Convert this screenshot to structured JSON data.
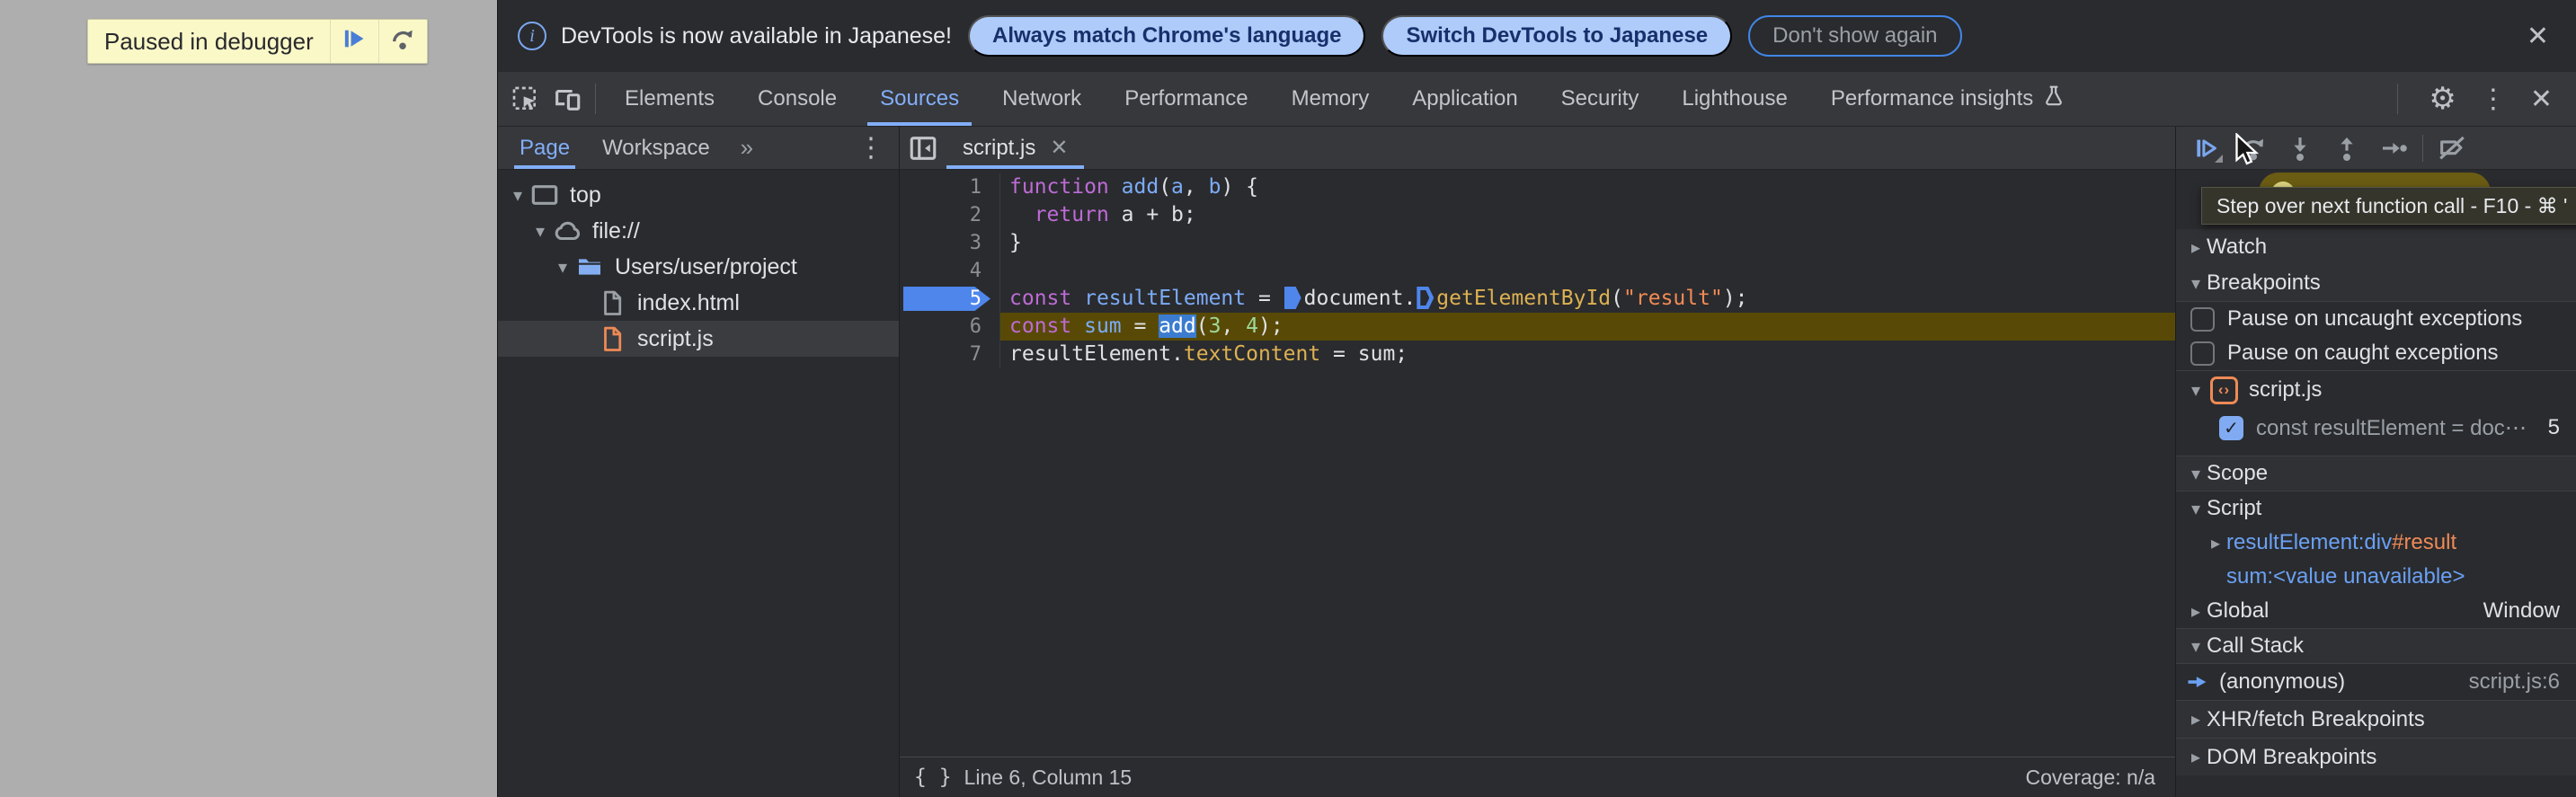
{
  "colors": {
    "accent_blue": "#82aef8",
    "breakpoint_blue": "#4e86ec",
    "paused_line": "#584a06",
    "string_orange": "#f28b54",
    "keyword_purple": "#bd6bd6",
    "banner_yellow": "#fbf8c8",
    "pill_blue": "#aecbfa"
  },
  "page": {
    "paused_banner": {
      "label": "Paused in debugger"
    }
  },
  "notification": {
    "text": "DevTools is now available in Japanese!",
    "actions": [
      "Always match Chrome's language",
      "Switch DevTools to Japanese"
    ],
    "dismiss": "Don't show again",
    "close_glyph": "✕"
  },
  "main_toolbar": {
    "tabs": [
      {
        "label": "Elements"
      },
      {
        "label": "Console"
      },
      {
        "label": "Sources",
        "active": true
      },
      {
        "label": "Network"
      },
      {
        "label": "Performance"
      },
      {
        "label": "Memory"
      },
      {
        "label": "Application"
      },
      {
        "label": "Security"
      },
      {
        "label": "Lighthouse"
      },
      {
        "label": "Performance insights",
        "icon": "flask-icon"
      }
    ],
    "gear_glyph": "⚙",
    "kebab_glyph": "⋮",
    "close_glyph": "✕"
  },
  "navigator": {
    "tabs": [
      {
        "label": "Page",
        "active": true
      },
      {
        "label": "Workspace"
      }
    ],
    "overflow_glyph": "»",
    "kebab_glyph": "⋮",
    "tree": [
      {
        "label": "top",
        "icon": "frame-icon",
        "caret": "▾"
      },
      {
        "label": "file://",
        "icon": "cloud-icon",
        "caret": "▾"
      },
      {
        "label": "Users/user/project",
        "icon": "folder-icon",
        "caret": "▾"
      },
      {
        "label": "index.html",
        "icon": "file-icon"
      },
      {
        "label": "script.js",
        "icon": "file-js-icon",
        "selected": true
      }
    ]
  },
  "editor": {
    "tab": {
      "label": "script.js",
      "close_glyph": "✕"
    },
    "breakpoint_line": 5,
    "paused_line": 6,
    "lines": [
      {
        "n": 1,
        "tokens": [
          [
            "kw",
            "function"
          ],
          [
            "pl",
            " "
          ],
          [
            "def",
            "add"
          ],
          [
            "pl",
            "("
          ],
          [
            "vr",
            "a"
          ],
          [
            "pl",
            ", "
          ],
          [
            "vr",
            "b"
          ],
          [
            "pl",
            ") {"
          ]
        ]
      },
      {
        "n": 2,
        "tokens": [
          [
            "pl",
            "  "
          ],
          [
            "kw",
            "return"
          ],
          [
            "pl",
            " a + b;"
          ]
        ]
      },
      {
        "n": 3,
        "tokens": [
          [
            "pl",
            "}"
          ]
        ]
      },
      {
        "n": 4,
        "tokens": []
      },
      {
        "n": 5,
        "tokens": [
          [
            "kw",
            "const"
          ],
          [
            "pl",
            " "
          ],
          [
            "vr",
            "resultElement"
          ],
          [
            "pl",
            " = "
          ],
          [
            "marker-filled",
            ""
          ],
          [
            "pl",
            "document."
          ],
          [
            "marker-hollow",
            ""
          ],
          [
            "fn",
            "getElementById"
          ],
          [
            "pl",
            "("
          ],
          [
            "st",
            "\"result\""
          ],
          [
            "pl",
            ");"
          ]
        ]
      },
      {
        "n": 6,
        "tokens": [
          [
            "kw",
            "const"
          ],
          [
            "pl",
            " "
          ],
          [
            "vr",
            "sum"
          ],
          [
            "pl",
            " = "
          ],
          [
            "sel",
            "add"
          ],
          [
            "pl",
            "("
          ],
          [
            "nm",
            "3"
          ],
          [
            "pl",
            ", "
          ],
          [
            "nm",
            "4"
          ],
          [
            "pl",
            ");"
          ]
        ]
      },
      {
        "n": 7,
        "tokens": [
          [
            "pl",
            "resultElement."
          ],
          [
            "fn",
            "textContent"
          ],
          [
            "pl",
            " = sum;"
          ]
        ]
      }
    ],
    "status": {
      "brace_glyph": "{ }",
      "line_col": "Line 6, Column 15",
      "coverage": "Coverage: n/a"
    }
  },
  "debugger": {
    "tooltip": "Step over next function call - F10 - ⌘ '",
    "sections": {
      "watch": {
        "title": "Watch"
      },
      "breakpoints": {
        "title": "Breakpoints",
        "checkboxes": [
          {
            "label": "Pause on uncaught exceptions",
            "checked": false
          },
          {
            "label": "Pause on caught exceptions",
            "checked": false
          }
        ],
        "group": {
          "file": "script.js",
          "icon_glyph": "‹›"
        },
        "entry": {
          "checked": true,
          "check_glyph": "✓",
          "code": "const resultElement = doc⋯",
          "line": "5"
        }
      },
      "scope": {
        "title": "Scope",
        "script_scope": "Script",
        "vars": [
          {
            "name": "resultElement: ",
            "value_tag": "div",
            "value_id": "#result"
          },
          {
            "name": "sum: ",
            "value": "<value unavailable>"
          }
        ],
        "global_scope": "Global",
        "global_value": "Window"
      },
      "call_stack": {
        "title": "Call Stack",
        "frame": {
          "name": "(anonymous)",
          "location": "script.js:6"
        }
      },
      "xhr": {
        "title": "XHR/fetch Breakpoints"
      },
      "dom": {
        "title": "DOM Breakpoints"
      }
    }
  }
}
